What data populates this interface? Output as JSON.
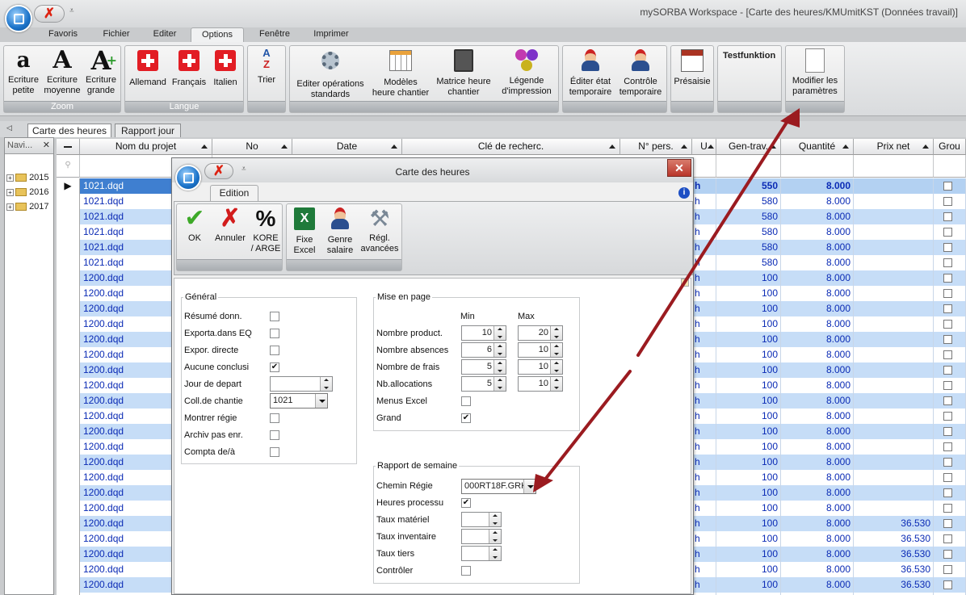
{
  "app": {
    "title": "mySORBA Workspace - [Carte des heures/KMUmitKST (Données travail)]"
  },
  "menu": [
    "Favoris",
    "Fichier",
    "Editer",
    "Options",
    "Fenêtre",
    "Imprimer"
  ],
  "ribbon": {
    "groups": {
      "zoom": {
        "label": "Zoom",
        "buttons": [
          "Ecriture\npetite",
          "Ecriture\nmoyenne",
          "Ecriture\ngrande"
        ]
      },
      "langue": {
        "label": "Langue",
        "buttons": [
          "Allemand",
          "Français",
          "Italien"
        ]
      },
      "trier": "Trier",
      "ops": [
        "Editer opérations\nstandards",
        "Modèles\nheure chantier",
        "Matrice heure\nchantier",
        "Légende\nd'impression"
      ],
      "etat": [
        "Éditer état\ntemporaire",
        "Contrôle\ntemporaire"
      ],
      "presaisie": "Présaisie",
      "testfunktion": "Testfunktion",
      "modifier": "Modifier les\nparamètres"
    }
  },
  "doc_tabs": [
    "Carte des heures",
    "Rapport jour"
  ],
  "nav": {
    "title": "Navi...",
    "items": [
      "2015",
      "2016",
      "2017"
    ]
  },
  "grid": {
    "headers": [
      "Nom du projet",
      "No",
      "Date",
      "Clé de recherc.",
      "N° pers.",
      "U",
      "Gen-trav.",
      "Quantité",
      "Prix net",
      "Grou"
    ],
    "rows": [
      {
        "proj": "1021.dqd",
        "u": "h",
        "gen": "550",
        "qty": "8.000",
        "prix": ""
      },
      {
        "proj": "1021.dqd",
        "u": "h",
        "gen": "580",
        "qty": "8.000",
        "prix": ""
      },
      {
        "proj": "1021.dqd",
        "u": "h",
        "gen": "580",
        "qty": "8.000",
        "prix": ""
      },
      {
        "proj": "1021.dqd",
        "u": "h",
        "gen": "580",
        "qty": "8.000",
        "prix": ""
      },
      {
        "proj": "1021.dqd",
        "u": "h",
        "gen": "580",
        "qty": "8.000",
        "prix": ""
      },
      {
        "proj": "1021.dqd",
        "u": "h",
        "gen": "580",
        "qty": "8.000",
        "prix": ""
      },
      {
        "proj": "1200.dqd",
        "u": "h",
        "gen": "100",
        "qty": "8.000",
        "prix": ""
      },
      {
        "proj": "1200.dqd",
        "u": "h",
        "gen": "100",
        "qty": "8.000",
        "prix": ""
      },
      {
        "proj": "1200.dqd",
        "u": "h",
        "gen": "100",
        "qty": "8.000",
        "prix": ""
      },
      {
        "proj": "1200.dqd",
        "u": "h",
        "gen": "100",
        "qty": "8.000",
        "prix": ""
      },
      {
        "proj": "1200.dqd",
        "u": "h",
        "gen": "100",
        "qty": "8.000",
        "prix": ""
      },
      {
        "proj": "1200.dqd",
        "u": "h",
        "gen": "100",
        "qty": "8.000",
        "prix": ""
      },
      {
        "proj": "1200.dqd",
        "u": "h",
        "gen": "100",
        "qty": "8.000",
        "prix": ""
      },
      {
        "proj": "1200.dqd",
        "u": "h",
        "gen": "100",
        "qty": "8.000",
        "prix": ""
      },
      {
        "proj": "1200.dqd",
        "u": "h",
        "gen": "100",
        "qty": "8.000",
        "prix": ""
      },
      {
        "proj": "1200.dqd",
        "u": "h",
        "gen": "100",
        "qty": "8.000",
        "prix": ""
      },
      {
        "proj": "1200.dqd",
        "u": "h",
        "gen": "100",
        "qty": "8.000",
        "prix": ""
      },
      {
        "proj": "1200.dqd",
        "u": "h",
        "gen": "100",
        "qty": "8.000",
        "prix": ""
      },
      {
        "proj": "1200.dqd",
        "u": "h",
        "gen": "100",
        "qty": "8.000",
        "prix": ""
      },
      {
        "proj": "1200.dqd",
        "u": "h",
        "gen": "100",
        "qty": "8.000",
        "prix": ""
      },
      {
        "proj": "1200.dqd",
        "u": "h",
        "gen": "100",
        "qty": "8.000",
        "prix": ""
      },
      {
        "proj": "1200.dqd",
        "u": "h",
        "gen": "100",
        "qty": "8.000",
        "prix": ""
      },
      {
        "proj": "1200.dqd",
        "u": "h",
        "gen": "100",
        "qty": "8.000",
        "prix": "36.530"
      },
      {
        "proj": "1200.dqd",
        "u": "h",
        "gen": "100",
        "qty": "8.000",
        "prix": "36.530"
      },
      {
        "proj": "1200.dqd",
        "u": "h",
        "gen": "100",
        "qty": "8.000",
        "prix": "36.530"
      },
      {
        "proj": "1200.dqd",
        "u": "h",
        "gen": "100",
        "qty": "8.000",
        "prix": "36.530"
      },
      {
        "proj": "1200.dqd",
        "u": "h",
        "gen": "100",
        "qty": "8.000",
        "prix": "36.530"
      },
      {
        "proj": "1200.dqd",
        "u": "h",
        "gen": "100",
        "qty": "8.000",
        "prix": "36.530"
      }
    ]
  },
  "dialog": {
    "title": "Carte des heures",
    "tab": "Edition",
    "buttons": [
      "OK",
      "Annuler",
      "KORE\n/ ARGE",
      "Fixe\nExcel",
      "Genre\nsalaire",
      "Régl.\navancées"
    ],
    "general": {
      "legend": "Général",
      "items": [
        {
          "label": "Résumé donn.",
          "type": "check",
          "checked": false
        },
        {
          "label": "Exporta.dans EQ",
          "type": "check",
          "checked": false
        },
        {
          "label": "Expor. directe",
          "type": "check",
          "checked": false
        },
        {
          "label": "Aucune conclusi",
          "type": "check",
          "checked": true
        },
        {
          "label": "Jour de depart",
          "type": "spin",
          "value": ""
        },
        {
          "label": "Coll.de chantie",
          "type": "combo",
          "value": "1021"
        },
        {
          "label": "Montrer régie",
          "type": "check",
          "checked": false
        },
        {
          "label": "Archiv pas enr.",
          "type": "check",
          "checked": false
        },
        {
          "label": "Compta de/à",
          "type": "check",
          "checked": false
        }
      ]
    },
    "mise": {
      "legend": "Mise en page",
      "min_label": "Min",
      "max_label": "Max",
      "rows": [
        {
          "label": "Nombre product.",
          "min": "10",
          "max": "20"
        },
        {
          "label": "Nombre absences",
          "min": "6",
          "max": "10"
        },
        {
          "label": "Nombre de frais",
          "min": "5",
          "max": "10"
        },
        {
          "label": "Nb.allocations",
          "min": "5",
          "max": "10"
        }
      ],
      "menus_excel": "Menus Excel",
      "grand": "Grand"
    },
    "rapport": {
      "legend": "Rapport de semaine",
      "chemin_label": "Chemin Régie",
      "chemin_value": "000RT18F.GRK",
      "heures": "Heures processu",
      "taux_mat": "Taux matériel",
      "taux_inv": "Taux inventaire",
      "taux_tiers": "Taux tiers",
      "controler": "Contrôler"
    }
  },
  "colors": {
    "row_alt": "#c6ddf7",
    "link_blue": "#0b2bb5",
    "arrow": "#9b1b20"
  }
}
